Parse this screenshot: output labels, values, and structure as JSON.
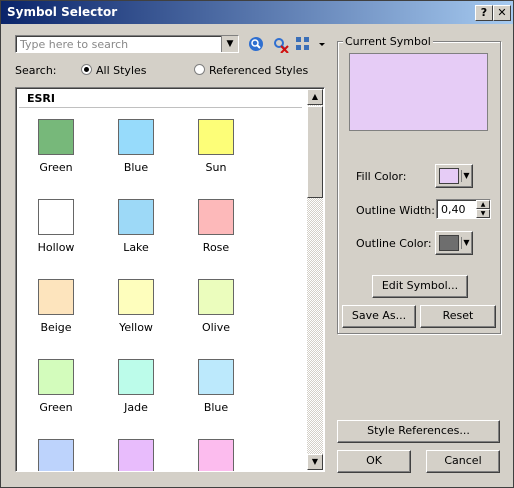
{
  "window": {
    "title": "Symbol Selector",
    "help_label": "?",
    "close_label": "✕"
  },
  "search": {
    "placeholder": "Type here to search",
    "scope_label": "Search:",
    "all_styles": "All Styles",
    "referenced_styles": "Referenced Styles",
    "selected_scope": "All Styles"
  },
  "gallery": {
    "group_title": "ESRI",
    "items": [
      {
        "name": "Green",
        "color": "#77b87a"
      },
      {
        "name": "Blue",
        "color": "#97dbfb"
      },
      {
        "name": "Sun",
        "color": "#fdfe78"
      },
      {
        "name": "Hollow",
        "color": "#ffffff"
      },
      {
        "name": "Lake",
        "color": "#9dd9f7"
      },
      {
        "name": "Rose",
        "color": "#fdb9ba"
      },
      {
        "name": "Beige",
        "color": "#fde4bd"
      },
      {
        "name": "Yellow",
        "color": "#fefebd"
      },
      {
        "name": "Olive",
        "color": "#ebfdbd"
      },
      {
        "name": "Green",
        "color": "#d3fcbc"
      },
      {
        "name": "Jade",
        "color": "#bcfcea"
      },
      {
        "name": "Blue",
        "color": "#bce9fc"
      },
      {
        "name": "",
        "color": "#bdd3fc"
      },
      {
        "name": "",
        "color": "#e8bcfc"
      },
      {
        "name": "",
        "color": "#fcbcee"
      }
    ]
  },
  "current_symbol": {
    "group_label": "Current Symbol",
    "preview_color": "#e6ccf6",
    "fill_color_label": "Fill Color:",
    "fill_color": "#e6ccf6",
    "outline_width_label": "Outline Width:",
    "outline_width": "0,40",
    "outline_color_label": "Outline Color:",
    "outline_color": "#6e6e6e",
    "edit_symbol": "Edit Symbol...",
    "save_as": "Save As...",
    "reset": "Reset"
  },
  "footer": {
    "style_references": "Style References...",
    "ok": "OK",
    "cancel": "Cancel"
  }
}
